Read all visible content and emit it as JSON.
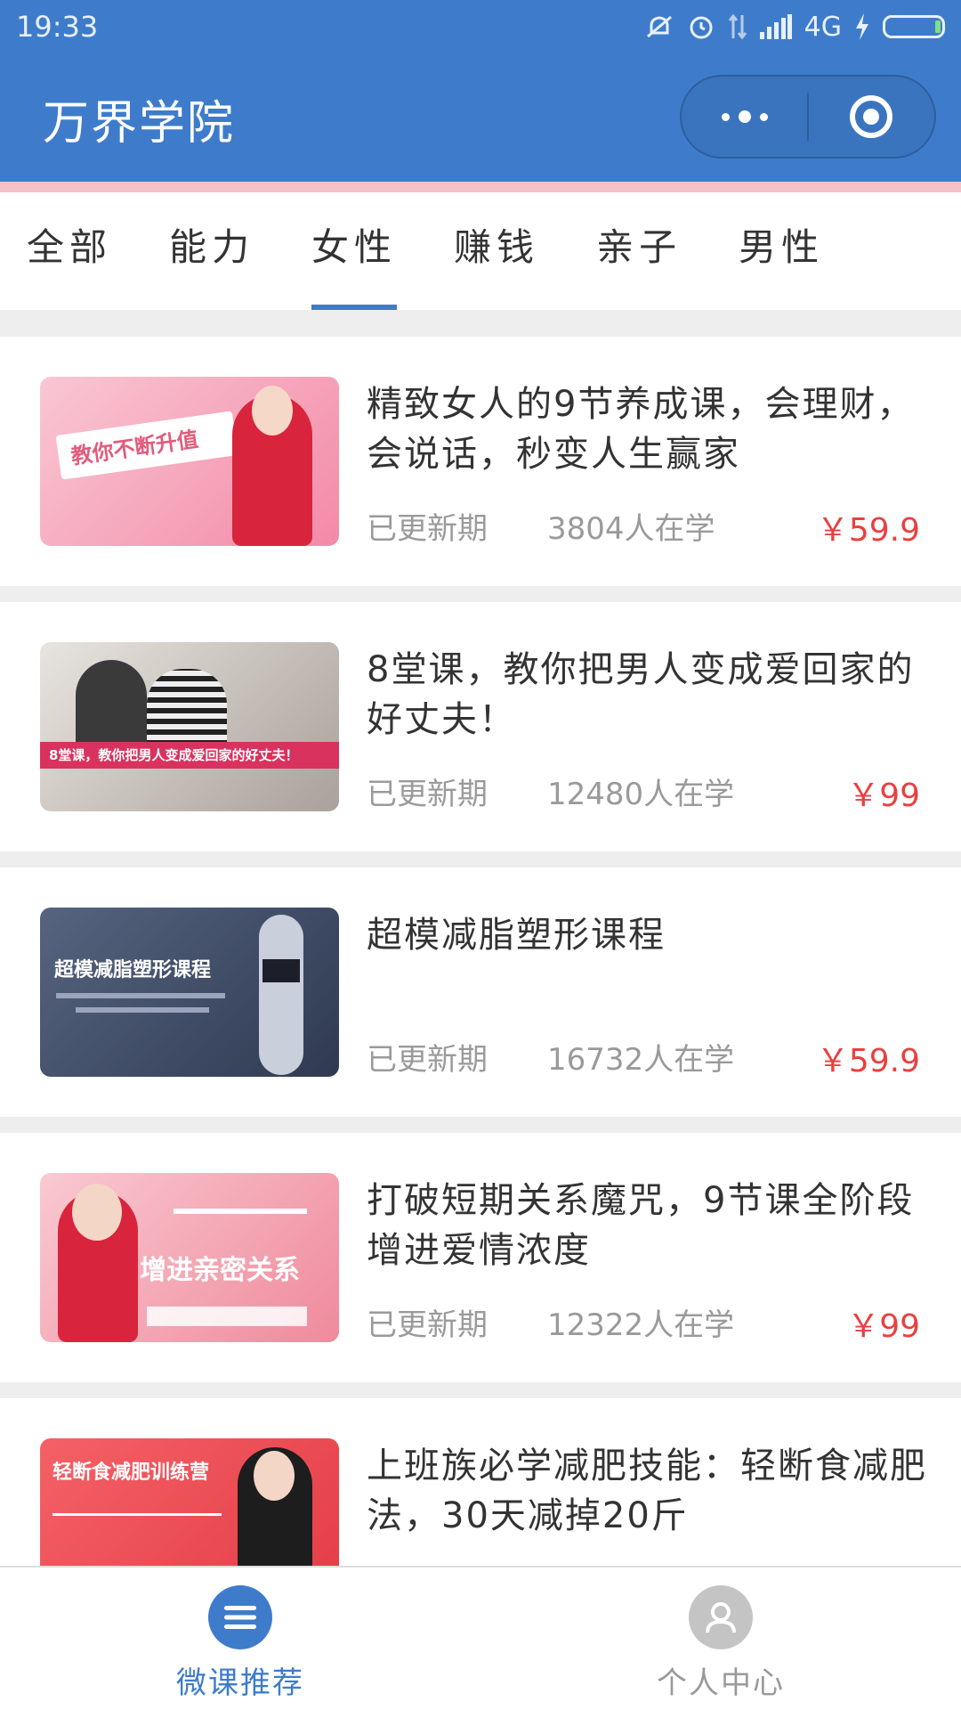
{
  "status_bar": {
    "time": "19:33",
    "network": "4G",
    "icons": [
      "mute-icon",
      "alarm-icon",
      "data-arrows-icon",
      "signal-icon",
      "charging-icon",
      "battery-icon"
    ]
  },
  "header": {
    "title": "万界学院",
    "capsule": {
      "more_icon": "more-dots-icon",
      "close_icon": "target-circle-icon"
    }
  },
  "tabs": [
    {
      "label": "全部",
      "active": false
    },
    {
      "label": "能力",
      "active": false
    },
    {
      "label": "女性",
      "active": true
    },
    {
      "label": "赚钱",
      "active": false
    },
    {
      "label": "亲子",
      "active": false
    },
    {
      "label": "男性",
      "active": false
    }
  ],
  "courses": [
    {
      "title": "精致女人的9节养成课，会理财，会说话，秒变人生赢家",
      "status": "已更新期",
      "learners": "3804人在学",
      "price": "￥59.9",
      "thumb": {
        "colors": [
          "#f7b7c7",
          "#f38aa8"
        ],
        "text": "教你不断升值"
      }
    },
    {
      "title": "8堂课，教你把男人变成爱回家的好丈夫！",
      "status": "已更新期",
      "learners": "12480人在学",
      "price": "￥99",
      "thumb": {
        "colors": [
          "#d9d5cf",
          "#a9a19a"
        ],
        "text": "8堂课，教你把男人变成爱回家的好丈夫！"
      }
    },
    {
      "title": "超模减脂塑形课程",
      "status": "已更新期",
      "learners": "16732人在学",
      "price": "￥59.9",
      "thumb": {
        "colors": [
          "#4f5d78",
          "#2f3a52"
        ],
        "text": "超模减脂塑形课程"
      }
    },
    {
      "title": "打破短期关系魔咒，9节课全阶段增进爱情浓度",
      "status": "已更新期",
      "learners": "12322人在学",
      "price": "￥99",
      "thumb": {
        "colors": [
          "#f6b8c2",
          "#ef8a9c"
        ],
        "text": "增进亲密关系"
      }
    },
    {
      "title": "上班族必学减肥技能：轻断食减肥法，30天减掉20斤",
      "status": "",
      "learners": "",
      "price": "",
      "thumb": {
        "colors": [
          "#f15a60",
          "#e43c46"
        ],
        "text": "轻断食减肥训练营"
      }
    }
  ],
  "bottom_nav": [
    {
      "label": "微课推荐",
      "icon": "menu-lines-icon",
      "active": true,
      "color": "#3e7ccb"
    },
    {
      "label": "个人中心",
      "icon": "user-avatar-icon",
      "active": false,
      "color": "#9a9a9a"
    }
  ],
  "colors": {
    "primary": "#3e7ccb",
    "price": "#e94040"
  }
}
